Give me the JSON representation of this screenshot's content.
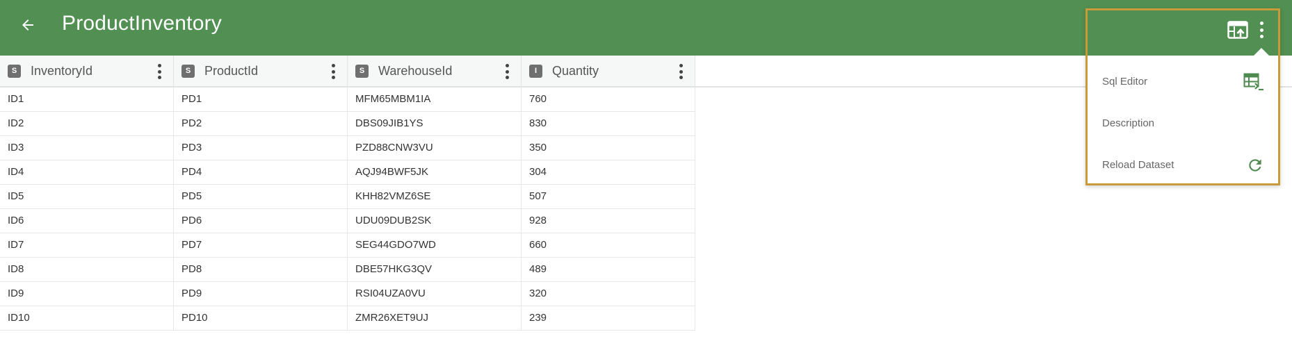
{
  "app": {
    "title": "ProductInventory"
  },
  "icons": {
    "back": "arrow-left-icon",
    "upload": "table-upload-icon",
    "more": "more-vertical-icon",
    "sql": "sql-table-icon",
    "reload": "refresh-icon"
  },
  "colors": {
    "appbar": "#518f52",
    "highlight_border": "#c89a3a",
    "icon_green": "#4e8a4f"
  },
  "columns": [
    {
      "type": "S",
      "label": "InventoryId"
    },
    {
      "type": "S",
      "label": "ProductId"
    },
    {
      "type": "S",
      "label": "WarehouseId"
    },
    {
      "type": "I",
      "label": "Quantity"
    }
  ],
  "rows": [
    [
      "ID1",
      "PD1",
      "MFM65MBM1IA",
      "760"
    ],
    [
      "ID2",
      "PD2",
      "DBS09JIB1YS",
      "830"
    ],
    [
      "ID3",
      "PD3",
      "PZD88CNW3VU",
      "350"
    ],
    [
      "ID4",
      "PD4",
      "AQJ94BWF5JK",
      "304"
    ],
    [
      "ID5",
      "PD5",
      "KHH82VMZ6SE",
      "507"
    ],
    [
      "ID6",
      "PD6",
      "UDU09DUB2SK",
      "928"
    ],
    [
      "ID7",
      "PD7",
      "SEG44GDO7WD",
      "660"
    ],
    [
      "ID8",
      "PD8",
      "DBE57HKG3QV",
      "489"
    ],
    [
      "ID9",
      "PD9",
      "RSI04UZA0VU",
      "320"
    ],
    [
      "ID10",
      "PD10",
      "ZMR26XET9UJ",
      "239"
    ]
  ],
  "menu": {
    "items": [
      {
        "label": "Sql Editor"
      },
      {
        "label": "Description"
      },
      {
        "label": "Reload Dataset"
      }
    ]
  }
}
